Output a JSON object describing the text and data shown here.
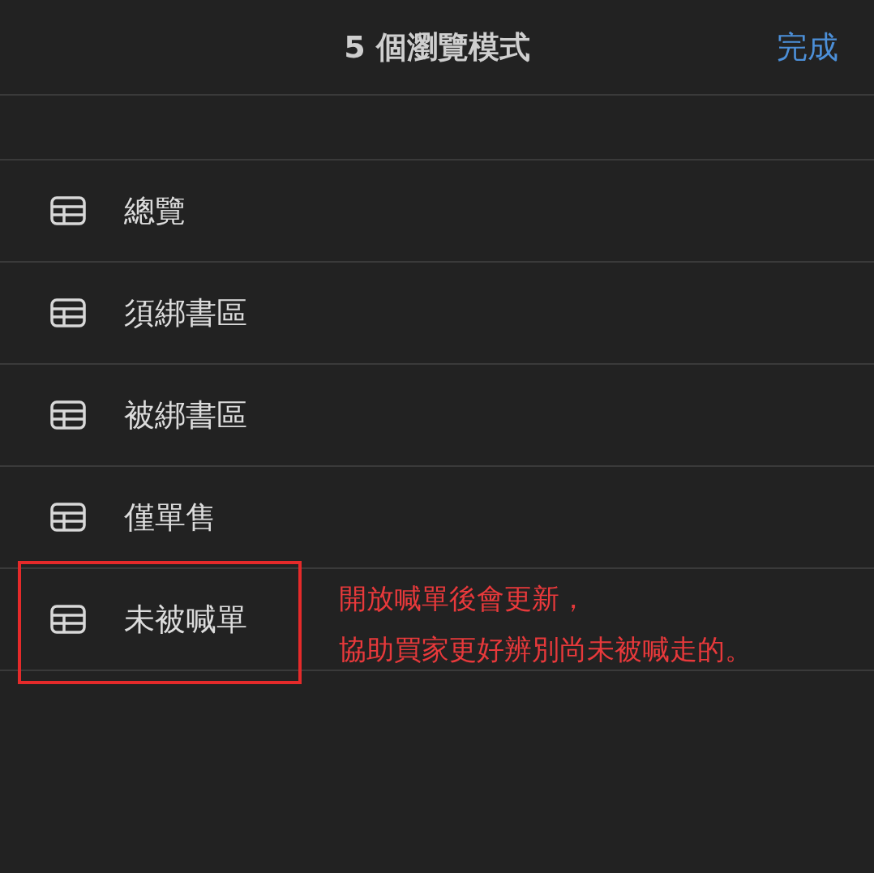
{
  "header": {
    "title": "5 個瀏覽模式",
    "done_button": "完成"
  },
  "views": [
    {
      "label": "總覽"
    },
    {
      "label": "須綁書區"
    },
    {
      "label": "被綁書區"
    },
    {
      "label": "僅單售"
    },
    {
      "label": "未被喊單"
    }
  ],
  "annotation": {
    "lines": [
      "開放喊單後會更新，",
      "協助買家更好辨別尚未被喊走的。"
    ]
  }
}
